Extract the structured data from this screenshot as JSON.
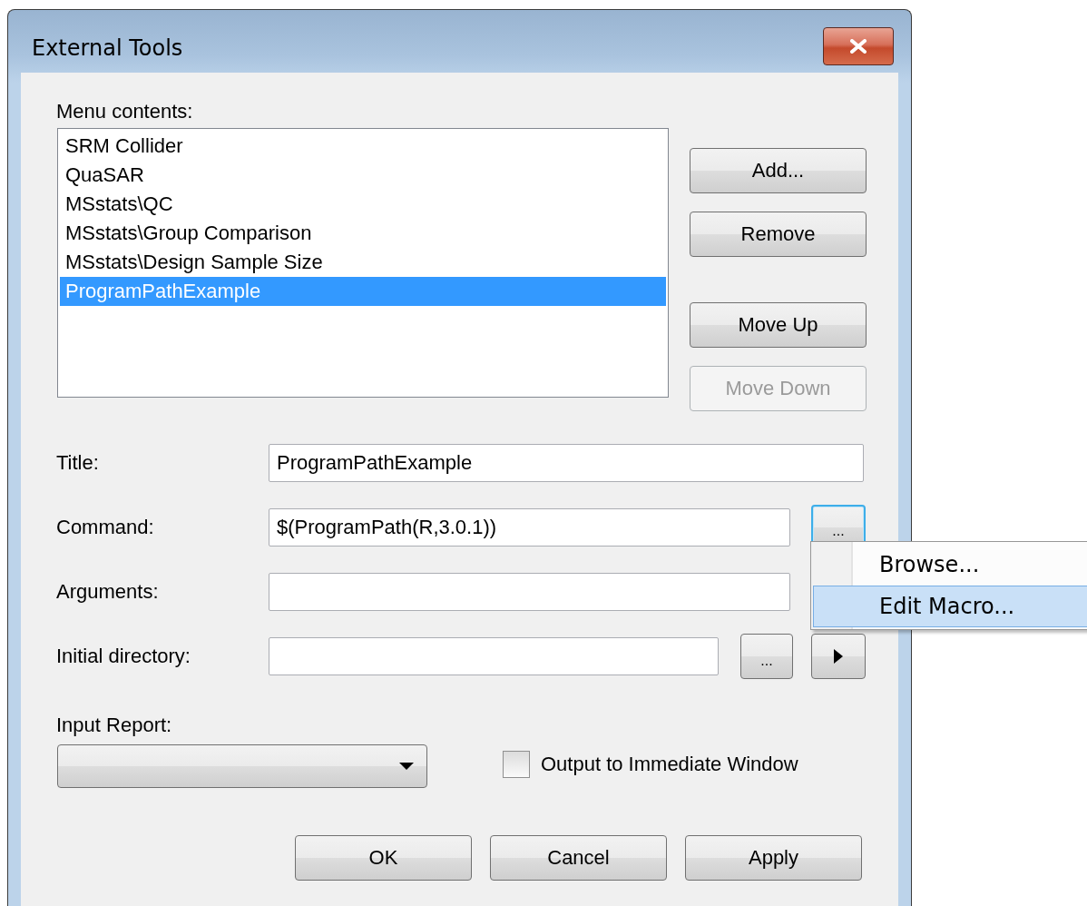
{
  "window": {
    "title": "External Tools"
  },
  "menu_contents": {
    "label": "Menu contents:",
    "items": [
      {
        "label": "SRM Collider",
        "selected": false
      },
      {
        "label": "QuaSAR",
        "selected": false
      },
      {
        "label": "MSstats\\QC",
        "selected": false
      },
      {
        "label": "MSstats\\Group Comparison",
        "selected": false
      },
      {
        "label": "MSstats\\Design Sample Size",
        "selected": false
      },
      {
        "label": "ProgramPathExample",
        "selected": true
      }
    ]
  },
  "side_buttons": [
    {
      "label": "Add...",
      "disabled": false
    },
    {
      "label": "Remove",
      "disabled": false
    },
    {
      "label": "Move Up",
      "disabled": false
    },
    {
      "label": "Move Down",
      "disabled": true
    }
  ],
  "fields": [
    {
      "label": "Title:",
      "value": "ProgramPathExample"
    },
    {
      "label": "Command:",
      "value": "$(ProgramPath(R,3.0.1))",
      "browse_button": {
        "label": "...",
        "focused": true
      }
    },
    {
      "label": "Arguments:"
    },
    {
      "label": "Initial directory:",
      "browse_button": {
        "label": "...",
        "focused": false
      },
      "has_arrow_button": true
    }
  ],
  "input_report": {
    "label": "Input Report:"
  },
  "output_checkbox": {
    "label": "Output to Immediate Window",
    "checked": false
  },
  "dialog_buttons": [
    "OK",
    "Cancel",
    "Apply"
  ],
  "context_menu": {
    "items": [
      {
        "label": "Browse...",
        "selected": false
      },
      {
        "label": "Edit Macro...",
        "selected": true
      }
    ]
  }
}
